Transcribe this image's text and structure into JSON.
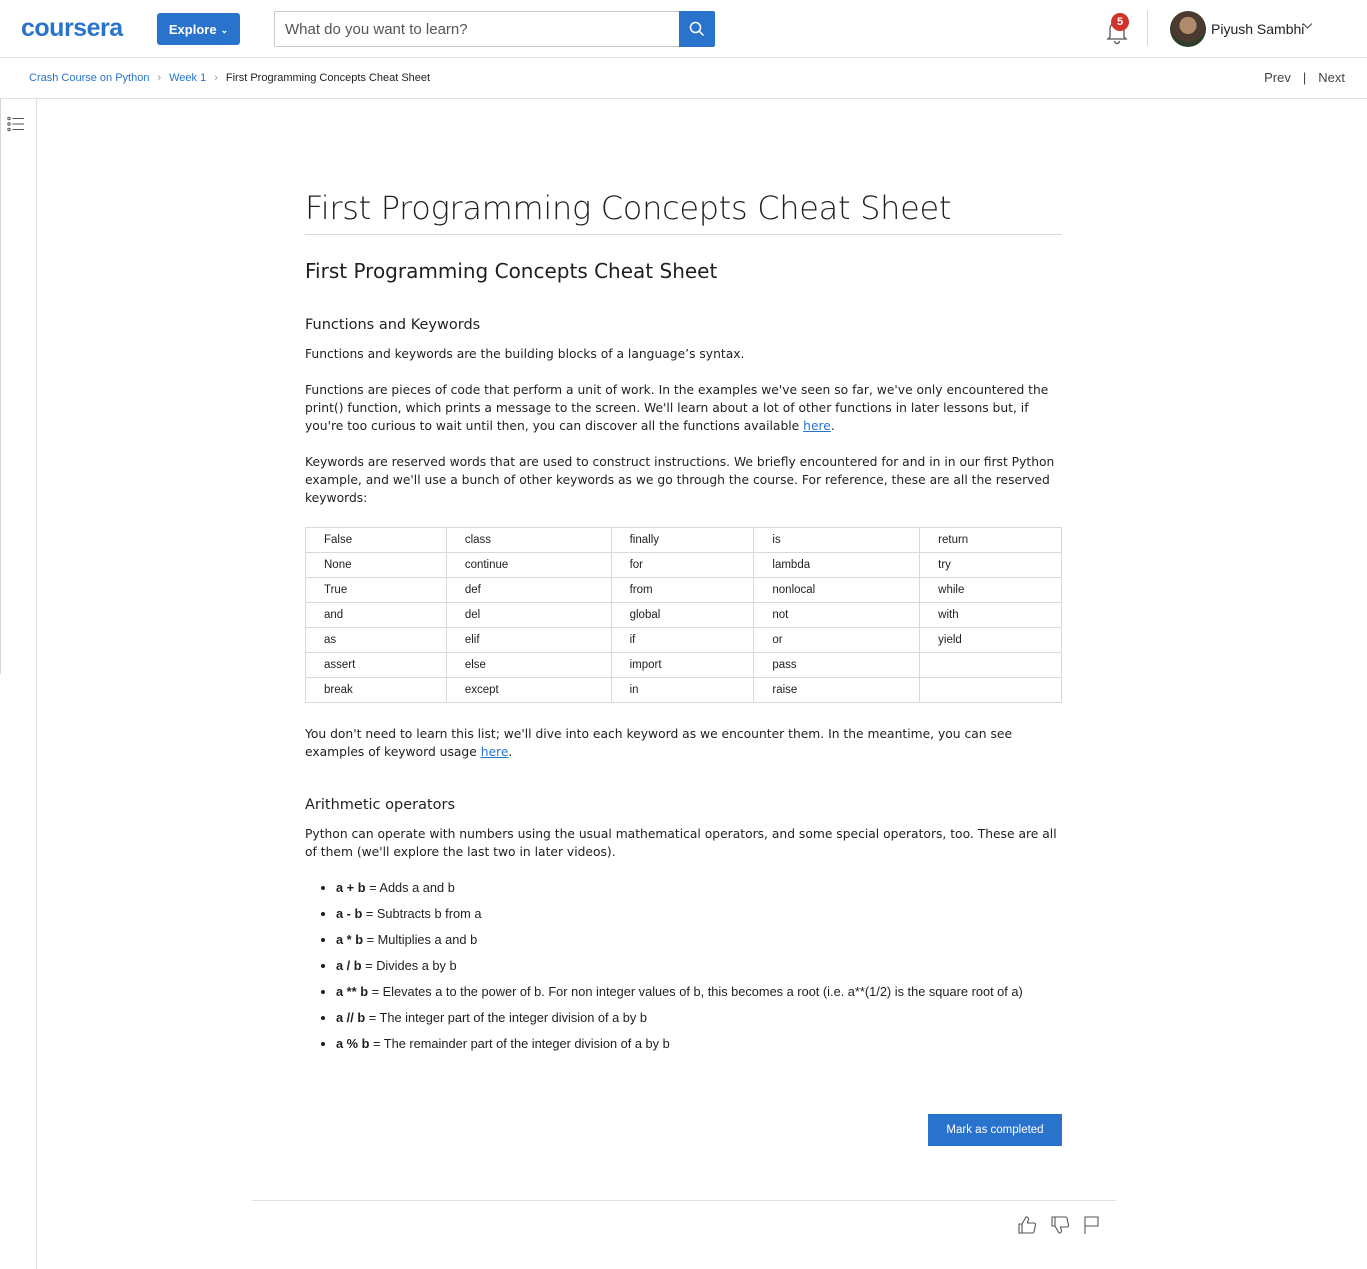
{
  "header": {
    "logo": "coursera",
    "explore_label": "Explore",
    "search_placeholder": "What do you want to learn?",
    "notification_count": "5",
    "user_name": "Piyush Sambhi"
  },
  "breadcrumb": {
    "items": [
      "Crash Course on Python",
      "Week 1",
      "First Programming Concepts Cheat Sheet"
    ],
    "prev_label": "Prev",
    "separator": "|",
    "next_label": "Next"
  },
  "content": {
    "page_title": "First Programming Concepts Cheat Sheet",
    "subtitle": "First Programming Concepts Cheat Sheet",
    "section1_heading": "Functions and Keywords",
    "p1": "Functions and keywords are the building blocks of a language’s syntax.",
    "p2_before": "Functions are pieces of code that perform a unit of work. In the examples we've seen so far, we've only encountered the print() function, which prints a message to the screen. We'll learn about a lot of other functions in later lessons but, if you're too curious to wait until then, you can discover all the functions available ",
    "p2_link": "here",
    "p2_after": ".",
    "p3": "Keywords are reserved words that are used to construct instructions. We briefly encountered for and in in our first Python example, and we'll use a bunch of other keywords as we go through the course. For reference, these are all the reserved keywords:",
    "keywords_table": [
      [
        "False",
        "class",
        "finally",
        "is",
        "return"
      ],
      [
        "None",
        "continue",
        "for",
        "lambda",
        "try"
      ],
      [
        "True",
        "def",
        "from",
        "nonlocal",
        "while"
      ],
      [
        "and",
        "del",
        "global",
        "not",
        "with"
      ],
      [
        "as",
        "elif",
        "if",
        "or",
        "yield"
      ],
      [
        "assert",
        "else",
        "import",
        "pass",
        ""
      ],
      [
        "break",
        "except",
        "in",
        "raise",
        ""
      ]
    ],
    "p4_before": "You don't need to learn this list; we'll dive into each keyword as we encounter them. In the meantime, you can see examples of keyword usage ",
    "p4_link": "here",
    "p4_after": ".",
    "section2_heading": "Arithmetic operators",
    "p5": "Python can operate with numbers using the usual mathematical operators, and some special operators, too. These are all of them (we'll explore the last two in later videos).",
    "operators": [
      {
        "op": "a + b",
        "desc": " = Adds a and b"
      },
      {
        "op": "a - b",
        "desc": " = Subtracts b from a"
      },
      {
        "op": "a * b",
        "desc": " = Multiplies a and b"
      },
      {
        "op": "a / b",
        "desc": " = Divides a by b"
      },
      {
        "op": "a ** b",
        "desc": " = Elevates a to the power of b. For non integer values of b, this becomes a root (i.e. a**(1/2) is the square root of a)"
      },
      {
        "op": "a // b",
        "desc": " = The integer part of the integer division of a by b"
      },
      {
        "op": "a % b",
        "desc": " = The remainder part of the integer division of a by b"
      }
    ],
    "mark_completed_label": "Mark as completed"
  },
  "icons": {
    "search": "search-icon",
    "bell": "bell-icon",
    "toc": "list-icon",
    "like": "thumbs-up-icon",
    "dislike": "thumbs-down-icon",
    "flag": "flag-icon"
  },
  "colors": {
    "brand": "#2a73cc",
    "badge": "#d0342c"
  }
}
